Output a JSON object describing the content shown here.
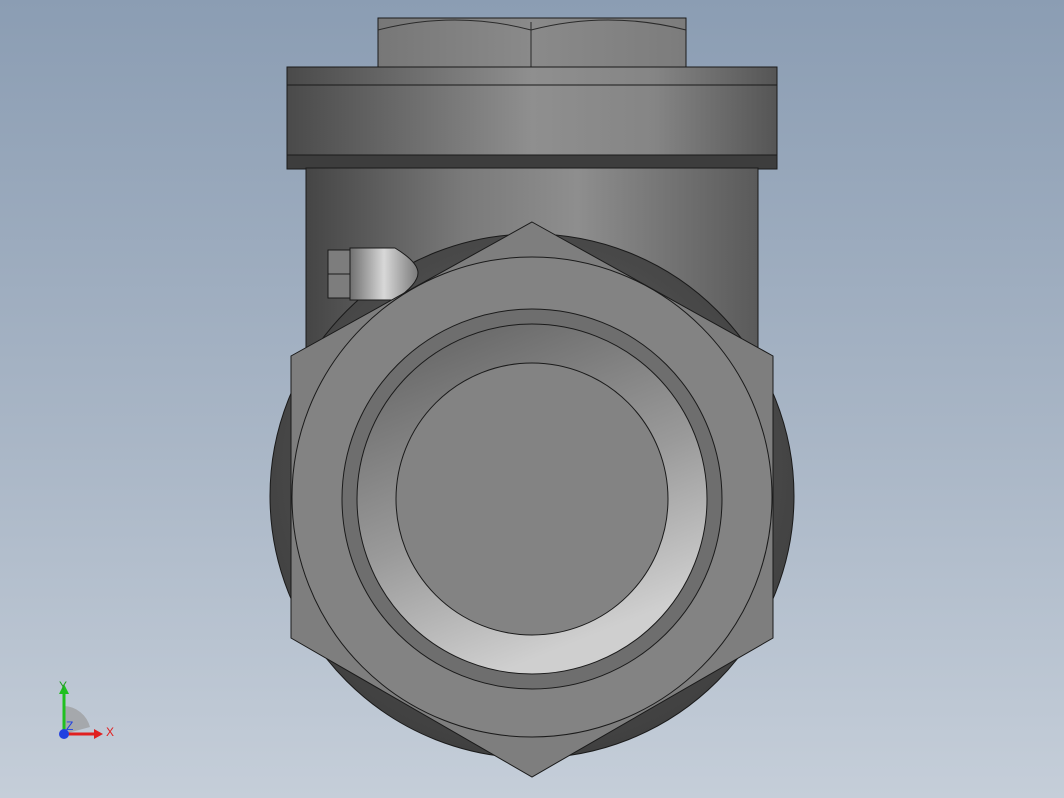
{
  "viewport": {
    "background_top": "#8b9db3",
    "background_bottom": "#c5ced9"
  },
  "triad": {
    "x_label": "X",
    "y_label": "Y",
    "z_label": "Z",
    "x_color": "#e02020",
    "y_color": "#20c020",
    "z_color": "#2040e0"
  }
}
